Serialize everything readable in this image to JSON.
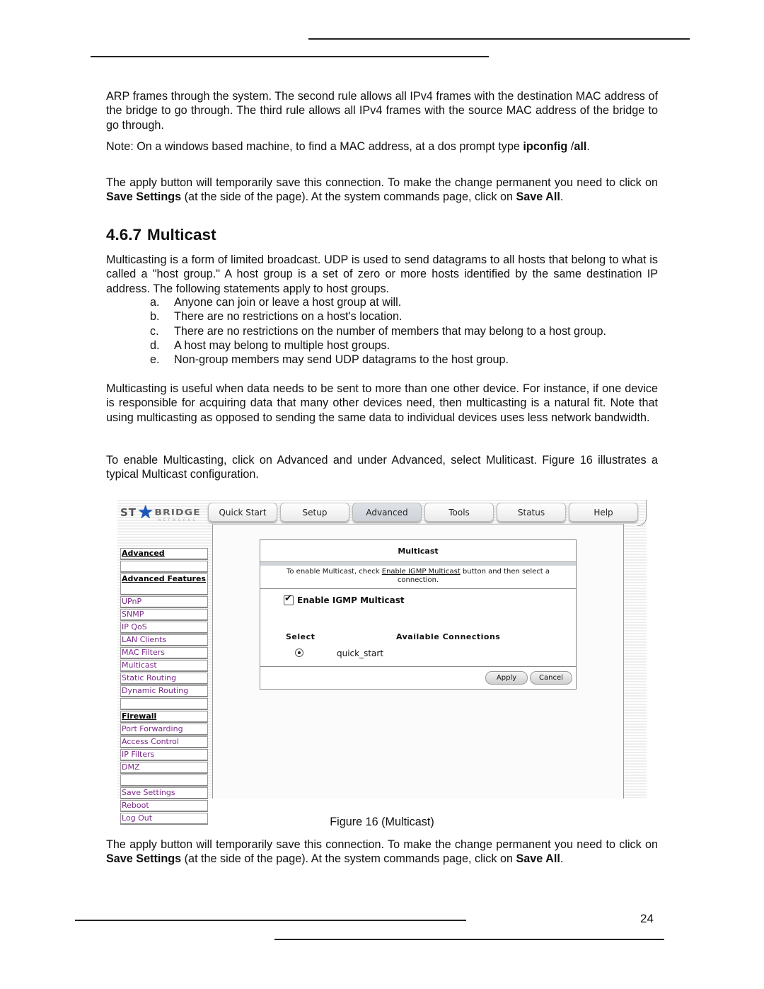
{
  "page": {
    "paragraphs": {
      "arp": "ARP frames through the system. The second rule allows all IPv4 frames with the destination MAC address of the bridge to go through. The third rule allows all IPv4 frames with the source MAC address of the bridge to go through.",
      "note_prefix": "Note: On a windows based machine, to find a MAC address, at a dos prompt type ",
      "note_cmd1": "ipconfig",
      "note_cmd_sep": " /",
      "note_cmd2": "all",
      "note_end": ".",
      "apply1_a": "The apply button will temporarily save this connection. To make the change permanent you need to click on ",
      "apply1_b": "Save Settings",
      "apply1_c": " (at the side of the page).  At the system commands page, click on ",
      "apply1_d": "Save All",
      "apply1_e": ".",
      "intro": "Multicasting is a form of limited broadcast. UDP is used to send datagrams to all hosts that belong to what is called a \"host group.\" A host group is a set of zero or more hosts identified by the same destination IP address. The following statements apply to host groups.",
      "useful": "Multicasting is useful when data needs to be sent to more than one other device. For instance, if one device is responsible for acquiring data that many other devices need, then multicasting is a natural fit. Note that using multicasting as opposed to sending the same data to individual devices uses less network bandwidth.",
      "enable": "To enable Multicasting, click on Advanced and under Advanced, select Muliticast. Figure 16 illustrates a typical Multicast configuration.",
      "apply2_a": "The apply button will temporarily save this connection. To make the change permanent you need to click on ",
      "apply2_b": "Save Settings",
      "apply2_c": " (at the side of the page).  At the system commands page, click on ",
      "apply2_d": "Save All",
      "apply2_e": "."
    },
    "heading": {
      "number": "4.6.7",
      "title": "Multicast"
    },
    "list": [
      {
        "label": "a.",
        "text": "Anyone can join or leave a host group at will."
      },
      {
        "label": "b.",
        "text": "There are no restrictions on a host's location."
      },
      {
        "label": "c.",
        "text": "There are no restrictions on the number of members that may belong to a host group."
      },
      {
        "label": "d.",
        "text": "A host may belong to multiple host groups."
      },
      {
        "label": "e.",
        "text": "Non-group members may send UDP datagrams to the host group."
      }
    ],
    "caption": "Figure 16 (Multicast)",
    "page_number": "24"
  },
  "figure": {
    "logo": {
      "left": "ST",
      "icon": "star-icon",
      "right": "BRIDGE",
      "sub": "NETWORKS"
    },
    "tabs": [
      {
        "label": "Quick Start",
        "active": false
      },
      {
        "label": "Setup",
        "active": false
      },
      {
        "label": "Advanced",
        "active": true
      },
      {
        "label": "Tools",
        "active": false
      },
      {
        "label": "Status",
        "active": false
      },
      {
        "label": "Help",
        "active": false
      }
    ],
    "sidebar": [
      {
        "label": "Advanced",
        "type": "head"
      },
      {
        "label": "",
        "type": "blank"
      },
      {
        "label": "Advanced Features",
        "type": "head-tall"
      },
      {
        "label": "UPnP",
        "type": "link"
      },
      {
        "label": "SNMP",
        "type": "link"
      },
      {
        "label": "IP QoS",
        "type": "link"
      },
      {
        "label": "LAN Clients",
        "type": "link"
      },
      {
        "label": "MAC Filters",
        "type": "link"
      },
      {
        "label": "Multicast",
        "type": "link"
      },
      {
        "label": "Static Routing",
        "type": "link"
      },
      {
        "label": "Dynamic Routing",
        "type": "link"
      },
      {
        "label": "",
        "type": "blank"
      },
      {
        "label": "Firewall",
        "type": "head"
      },
      {
        "label": "Port Forwarding",
        "type": "link"
      },
      {
        "label": "Access Control",
        "type": "link"
      },
      {
        "label": "IP Filters",
        "type": "link"
      },
      {
        "label": "DMZ",
        "type": "link"
      },
      {
        "label": "",
        "type": "blank"
      },
      {
        "label": "Save Settings",
        "type": "link"
      },
      {
        "label": "Reboot",
        "type": "link"
      },
      {
        "label": "Log Out",
        "type": "link"
      }
    ],
    "panel": {
      "title": "Multicast",
      "desc_a": "To enable Multicast, check ",
      "desc_link": "Enable IGMP Multicast",
      "desc_b": " button and then select a connection.",
      "enable_label": "Enable IGMP Multicast",
      "enable_checked": true,
      "col_select": "Select",
      "col_available": "Available Connections",
      "connection": "quick_start",
      "connection_selected": true,
      "apply": "Apply",
      "cancel": "Cancel"
    },
    "colors": {
      "link": "#7a2a8a",
      "logo_star": "#1a57b8"
    }
  }
}
